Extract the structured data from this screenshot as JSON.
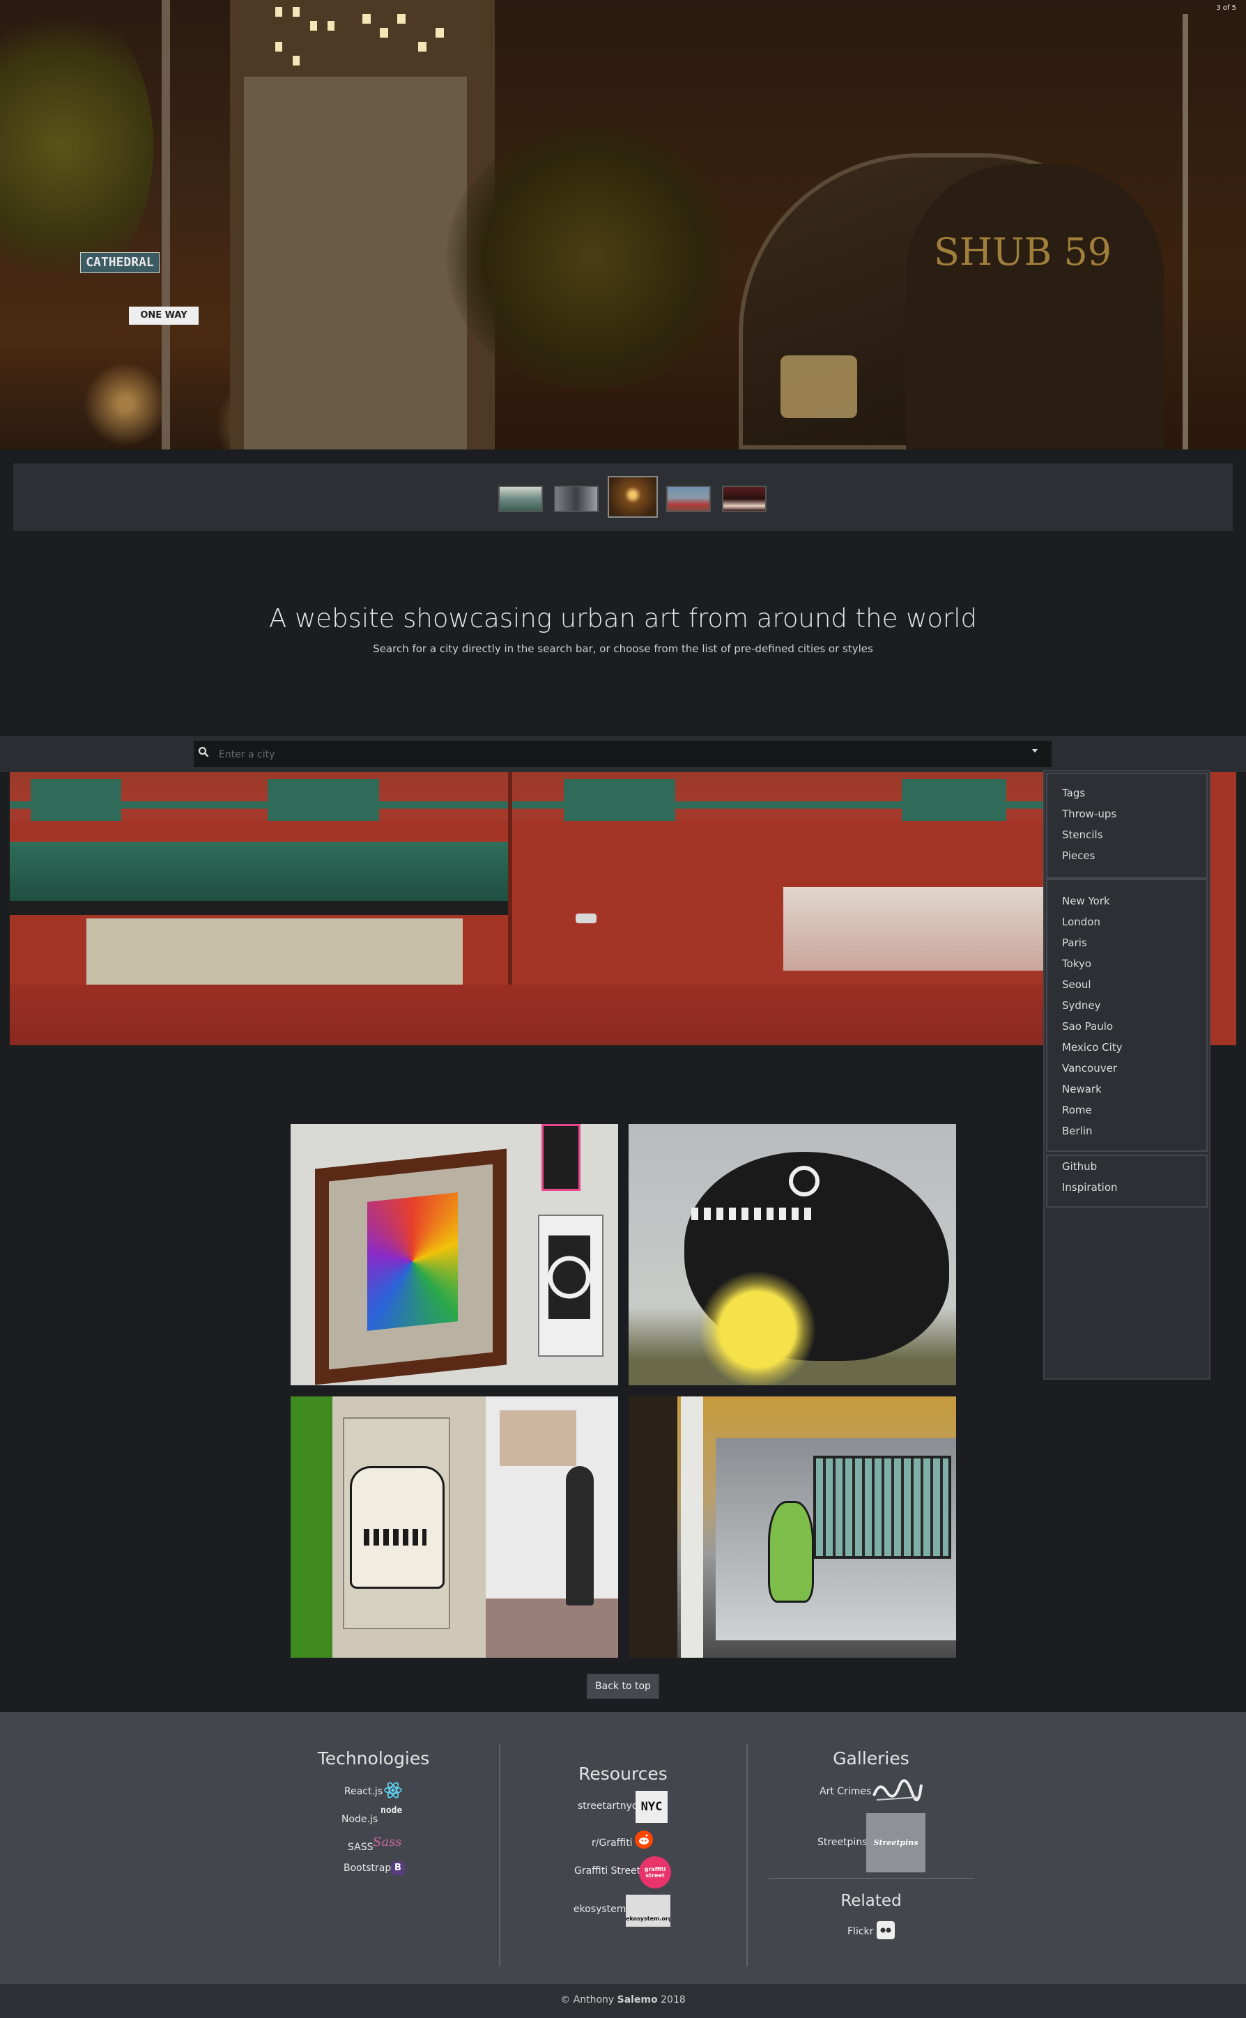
{
  "hero": {
    "counter": "3 of 5",
    "street_sign_1": "CATHEDRAL",
    "street_sign_2": "ONE WAY"
  },
  "thumbnails": {
    "count": 5,
    "active_index": 3
  },
  "intro": {
    "title": "A website showcasing urban art from around the world",
    "subtitle": "Search for a city directly in the search bar, or choose from the list of pre-defined cities or styles"
  },
  "search": {
    "placeholder": "Enter a city"
  },
  "sidebar": {
    "styles": [
      "Tags",
      "Throw-ups",
      "Stencils",
      "Pieces"
    ],
    "cities": [
      "New York",
      "London",
      "Paris",
      "Tokyo",
      "Seoul",
      "Sydney",
      "Sao Paulo",
      "Mexico City",
      "Vancouver",
      "Newark",
      "Rome",
      "Berlin"
    ],
    "links": [
      "Github",
      "Inspiration"
    ]
  },
  "back_to_top": "Back to top",
  "footer": {
    "technologies": {
      "heading": "Technologies",
      "items": [
        "React.js",
        "Node.js",
        "SASS",
        "Bootstrap"
      ],
      "logo_text": [
        "node",
        "Sass",
        "B"
      ]
    },
    "resources": {
      "heading": "Resources",
      "items": [
        "streetartnyc",
        "r/Graffiti",
        "Graffiti Street",
        "ekosystem"
      ],
      "logo_text": [
        "NYC",
        "graffiti street",
        "ekosystem.org"
      ]
    },
    "galleries": {
      "heading": "Galleries",
      "items": [
        "Art Crimes",
        "Streetpins"
      ],
      "logo_text": [
        "Streetpins"
      ]
    },
    "related": {
      "heading": "Related",
      "items": [
        "Flickr"
      ]
    }
  },
  "copyright": {
    "prefix": "© Anthony",
    "name": "Salemo",
    "year": "2018"
  },
  "colors": {
    "page_bg": "#1b1d20",
    "panel_bg": "#2c2f33",
    "footer_bg": "#43474d",
    "react_blue": "#61dafb",
    "sass_pink": "#cd6799",
    "bootstrap_purple": "#563d7c",
    "reddit_orange": "#ff4500",
    "graffiti_street_pink": "#e8336b"
  }
}
